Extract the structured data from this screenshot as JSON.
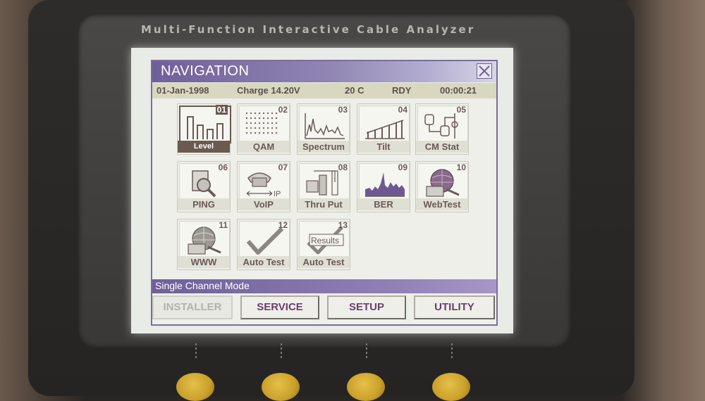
{
  "device": {
    "title": "Multi-Function Interactive Cable Analyzer"
  },
  "window": {
    "title": "NAVIGATION",
    "close_icon": "close-icon"
  },
  "status": {
    "date": "01-Jan-1998",
    "charge": "Charge 14.20V",
    "temp": "20 C",
    "state": "RDY",
    "time": "00:00:21"
  },
  "tiles": [
    {
      "num": "01",
      "label": "Level",
      "icon": "level-bars-icon",
      "selected": true
    },
    {
      "num": "02",
      "label": "QAM",
      "icon": "qam-constellation-icon"
    },
    {
      "num": "03",
      "label": "Spectrum",
      "icon": "spectrum-icon"
    },
    {
      "num": "04",
      "label": "Tilt",
      "icon": "tilt-icon"
    },
    {
      "num": "05",
      "label": "CM Stat",
      "icon": "cm-stat-icon"
    },
    {
      "num": "06",
      "label": "PING",
      "icon": "ping-icon"
    },
    {
      "num": "07",
      "label": "VoIP",
      "icon": "voip-phone-icon",
      "art_text": "IP"
    },
    {
      "num": "08",
      "label": "Thru Put",
      "icon": "throughput-icon"
    },
    {
      "num": "09",
      "label": "BER",
      "icon": "ber-icon"
    },
    {
      "num": "10",
      "label": "WebTest",
      "icon": "web-test-icon"
    },
    {
      "num": "11",
      "label": "WWW",
      "icon": "www-globe-icon"
    },
    {
      "num": "12",
      "label": "Auto Test",
      "icon": "checkmark-icon"
    },
    {
      "num": "13",
      "label": "Auto Test",
      "icon": "results-check-icon",
      "art_text": "Results"
    }
  ],
  "mode": {
    "label": "Single Channel Mode"
  },
  "tabs": [
    {
      "label": "INSTALLER",
      "active": true
    },
    {
      "label": "SERVICE"
    },
    {
      "label": "SETUP"
    },
    {
      "label": "UTILITY"
    }
  ],
  "colors": {
    "accent": "#6f5f9a",
    "screen_bg": "#efefe9",
    "status_bg": "#d8d7c0",
    "tab_text": "#6a3f6a",
    "button": "#d4ad33"
  }
}
